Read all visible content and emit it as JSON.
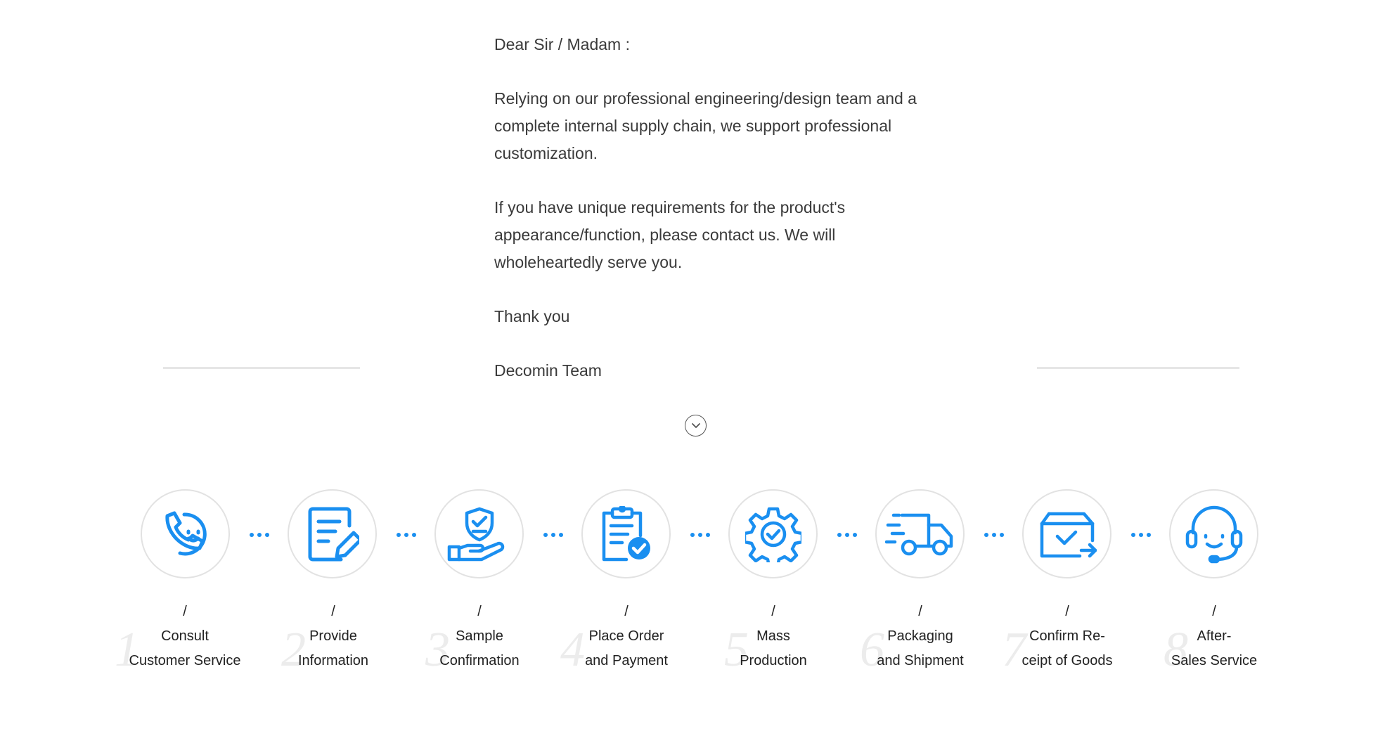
{
  "letter": {
    "greeting": "Dear Sir / Madam :",
    "paragraph1": "Relying on our professional engineering/design team and a complete internal supply chain, we support professional customization.",
    "paragraph2": "If you have unique requirements for the product's appearance/function, please contact us. We will wholeheartedly serve you.",
    "closing": "Thank you",
    "signature": "Decomin Team"
  },
  "expand_icon": "chevron-down-circle-icon",
  "accent_color": "#1a8ff0",
  "steps": [
    {
      "number": "1",
      "separator": "/",
      "line1": "Consult",
      "line2": "Customer Service",
      "icon": "phone-chat-icon"
    },
    {
      "number": "2",
      "separator": "/",
      "line1": "Provide",
      "line2": "Information",
      "icon": "document-edit-icon"
    },
    {
      "number": "3",
      "separator": "/",
      "line1": "Sample",
      "line2": "Confirmation",
      "icon": "hand-shield-icon"
    },
    {
      "number": "4",
      "separator": "/",
      "line1": "Place Order",
      "line2": "and Payment",
      "icon": "clipboard-check-icon"
    },
    {
      "number": "5",
      "separator": "/",
      "line1": "Mass",
      "line2": "Production",
      "icon": "gear-check-icon"
    },
    {
      "number": "6",
      "separator": "/",
      "line1": "Packaging",
      "line2": "and Shipment",
      "icon": "truck-icon"
    },
    {
      "number": "7",
      "separator": "/",
      "line1": "Confirm Re-",
      "line2": "ceipt of Goods",
      "icon": "box-check-icon"
    },
    {
      "number": "8",
      "separator": "/",
      "line1": "After-",
      "line2": "Sales Service",
      "icon": "headset-icon"
    }
  ]
}
